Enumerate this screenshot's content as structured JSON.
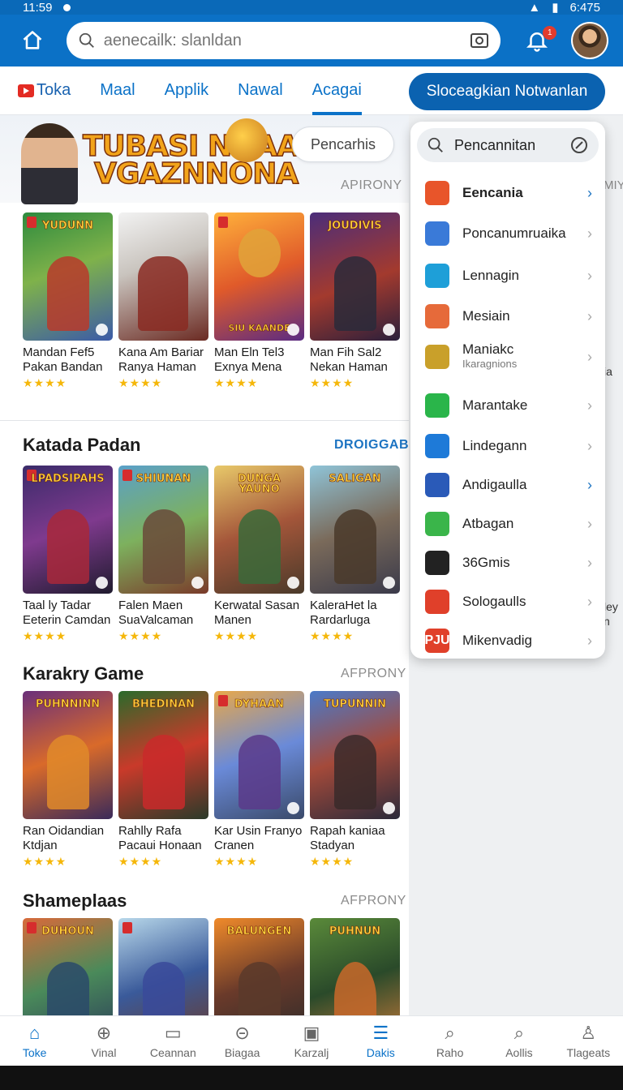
{
  "status": {
    "time": "11:59",
    "clock": "6:475"
  },
  "search": {
    "placeholder": "aenecailk: slanldan"
  },
  "notifications": {
    "badge": "1"
  },
  "tabs": [
    {
      "label": "Toka"
    },
    {
      "label": "Maal"
    },
    {
      "label": "Applik"
    },
    {
      "label": "Nawal"
    },
    {
      "label": "Acagai"
    }
  ],
  "tab_cta": "Sloceagkian Notwanlan",
  "hero": {
    "title_line1": "TUBASI NNAA",
    "title_line2": "VGAZNNONA",
    "pill": "Pencarhis",
    "more": "APIRONY"
  },
  "sections": [
    {
      "title": "",
      "more": "APIRONY",
      "cards": [
        {
          "art": "YUDUNN",
          "title": "Mandan Fef5 Pakan Bandan",
          "stars": "★★★★"
        },
        {
          "art": "",
          "title": "Kana Am Bariar Ranya Haman",
          "stars": "★★★★"
        },
        {
          "art": "SIU KAANDE",
          "title": "Man Eln Tel3 Exnya Mena",
          "stars": "★★★★"
        },
        {
          "art": "JOUDIVIS",
          "title": "Man Fih Sal2 Nekan Haman",
          "stars": "★★★★"
        }
      ]
    },
    {
      "title": "Katada Padan",
      "more": "DROIGGAB",
      "cards": [
        {
          "art": "LPADSIPAHS",
          "title": "Taal ly Tadar Eeterin Camdan",
          "stars": "★★★★"
        },
        {
          "art": "SHIUNAN",
          "title": "Falen Maen SuaValcaman",
          "stars": "★★★★"
        },
        {
          "art": "DUNGA YAUNO",
          "title": "Kerwatal Sasan Manen",
          "stars": "★★★★"
        },
        {
          "art": "SALIGAN",
          "title": "KaleraHet la Rardarluga",
          "stars": "★★★★"
        }
      ]
    },
    {
      "title": "Karakry Game",
      "more": "AFPRONY",
      "cards": [
        {
          "art": "PUHNNINN",
          "title": "Ran Oidandian Ktdjan",
          "stars": "★★★★"
        },
        {
          "art": "BHEDINAN",
          "title": "Rahlly Rafa Pacaui Honaan",
          "stars": "★★★★"
        },
        {
          "art": "DYHAAN",
          "title": "Kar Usin Franyo Cranen",
          "stars": "★★★★"
        },
        {
          "art": "TUPUNNIN",
          "title": "Rapah kaniaa Stadyan",
          "stars": "★★★★"
        }
      ]
    },
    {
      "title": "Shameplaas",
      "more": "AFPRONY",
      "cards": [
        {
          "art": "DUHOUN",
          "title": "",
          "stars": ""
        },
        {
          "art": "",
          "title": "",
          "stars": ""
        },
        {
          "art": "BALUNGEN",
          "title": "",
          "stars": ""
        },
        {
          "art": "PUHNUN",
          "title": "",
          "stars": ""
        }
      ]
    }
  ],
  "dropdown": {
    "search": "Pencannitan",
    "items": [
      {
        "label": "Eencania",
        "sub": "",
        "icon": "pinwheel-icon",
        "color": "#e8552a",
        "bold": true,
        "chev_blue": true
      },
      {
        "label": "Poncanumruaika",
        "sub": "",
        "icon": "game-thumb-icon",
        "color": "#3a7ad8"
      },
      {
        "label": "Lennagin",
        "sub": "",
        "icon": "screen-icon",
        "color": "#1e9fd8"
      },
      {
        "label": "Mesiain",
        "sub": "",
        "icon": "book-icon",
        "color": "#e66a3a"
      },
      {
        "label": "Maniakc",
        "sub": "Ikaragnions",
        "icon": "game-art-icon",
        "color": "#c9a02a"
      },
      {
        "label": "Marantake",
        "sub": "",
        "icon": "whatsapp-icon",
        "color": "#2ab54a"
      },
      {
        "label": "Lindegann",
        "sub": "",
        "icon": "photo-icon",
        "color": "#1e7ad8"
      },
      {
        "label": "Andigaulla",
        "sub": "",
        "icon": "facebook-icon",
        "color": "#2a5ab8",
        "chev_blue": true
      },
      {
        "label": "Atbagan",
        "sub": "",
        "icon": "chat-icon",
        "color": "#3ab54a"
      },
      {
        "label": "36Gmis",
        "sub": "",
        "icon": "x-icon",
        "color": "#222222"
      },
      {
        "label": "Sologaulls",
        "sub": "",
        "icon": "shield-icon",
        "color": "#e0402a"
      },
      {
        "label": "Mikenvadig",
        "sub": "",
        "icon": "pj-icon",
        "color": "#e0402a",
        "icon_text": "PJU"
      }
    ]
  },
  "right_peek": {
    "text1": "MIY",
    "text2": "ia",
    "text3": "ley",
    "text4": "n"
  },
  "bottom_nav": [
    {
      "label": "Toke",
      "icon": "home-icon",
      "active": true
    },
    {
      "label": "Vinal",
      "icon": "download-icon"
    },
    {
      "label": "Ceannan",
      "icon": "box-icon"
    },
    {
      "label": "Biagaa",
      "icon": "download-circle-icon"
    },
    {
      "label": "Karzalj",
      "icon": "gamepad-icon"
    },
    {
      "label": "Dakis",
      "icon": "list-icon",
      "active": true
    },
    {
      "label": "Raho",
      "icon": "search-icon"
    },
    {
      "label": "Aollis",
      "icon": "search-icon"
    },
    {
      "label": "Tlageats",
      "icon": "person-icon"
    }
  ],
  "colors": {
    "primary": "#0b71c6",
    "star": "#f5b70a",
    "accent_red": "#e32b23"
  }
}
